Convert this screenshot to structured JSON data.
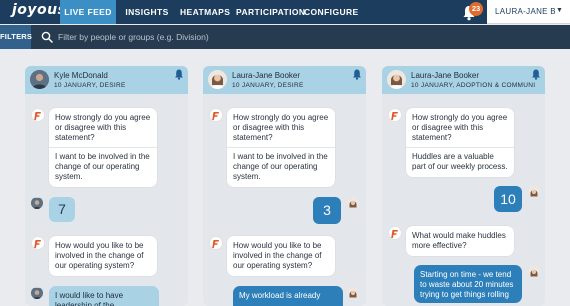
{
  "nav": {
    "logo": "joyous",
    "items": [
      {
        "label": "LIVE FEED",
        "active": true
      },
      {
        "label": "INSIGHTS",
        "active": false
      },
      {
        "label": "HEATMAPS",
        "active": false
      },
      {
        "label": "PARTICIPATION",
        "active": false
      },
      {
        "label": "CONFIGURE",
        "active": false
      }
    ],
    "notification_count": "23",
    "user_name": "LAURA-JANE B",
    "caret_icon": "caret-down-icon",
    "accent": "#3b8fc4",
    "bg": "#1d3d5f"
  },
  "filter_bar": {
    "filters_label": "FILTERS",
    "search_placeholder": "Filter by people or groups (e.g. Division)"
  },
  "columns": [
    {
      "name": "Kyle McDonald",
      "subtitle": "10 JANUARY, DESIRE",
      "q1": "How strongly do you agree or disagree with this statement?",
      "q1_detail": "I want to be involved in the change of our operating system.",
      "answer1": "7",
      "q2": "How would you like to be involved in the change of our operating system?",
      "answer2": "I would like to have leadership of the..."
    },
    {
      "name": "Laura-Jane Booker",
      "subtitle": "10 JANUARY, DESIRE",
      "q1": "How strongly do you agree or disagree with this statement?",
      "q1_detail": "I want to be involved in the change of our operating system.",
      "answer1": "3",
      "q2": "How would you like to be involved in the change of our operating system?",
      "answer2": "My workload is already"
    },
    {
      "name": "Laura-Jane Booker",
      "subtitle": "10 JANUARY, ADOPTION & COMMUNI...",
      "q1": "How strongly do you agree or disagree with this statement?",
      "q1_detail": "Huddles are a valuable part of our weekly process.",
      "answer1": "10",
      "q2": "What would make huddles more effective?",
      "answer2": "Starting on time - we tend to waste about 20 minutes trying to get things rolling"
    }
  ]
}
